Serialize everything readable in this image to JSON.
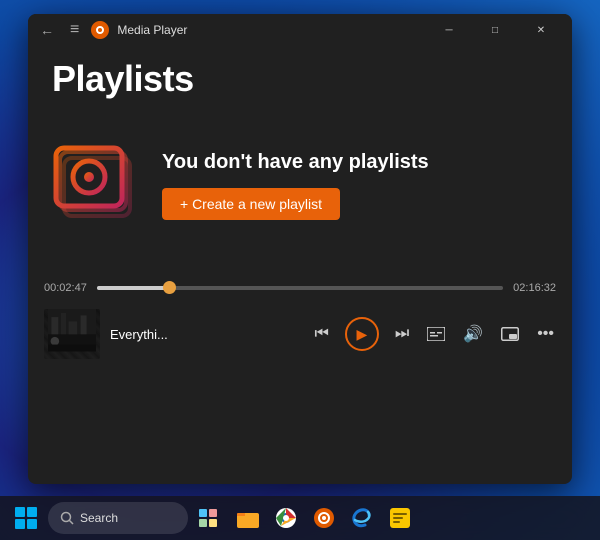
{
  "window": {
    "title": "Media Player",
    "titlebar": {
      "back_label": "←",
      "menu_label": "≡",
      "minimize_label": "─",
      "maximize_label": "□",
      "close_label": "✕"
    }
  },
  "page": {
    "title": "Playlists"
  },
  "empty_state": {
    "heading": "You don't have any playlists",
    "create_button": "+ Create a new playlist"
  },
  "player": {
    "current_time": "00:02:47",
    "total_time": "02:16:32",
    "song_title": "Everythi...",
    "progress_percent": 18
  },
  "taskbar": {
    "search_placeholder": "Search",
    "icons": [
      "🗂",
      "📁",
      "🌐",
      "▶",
      "🌙",
      "📋"
    ]
  }
}
